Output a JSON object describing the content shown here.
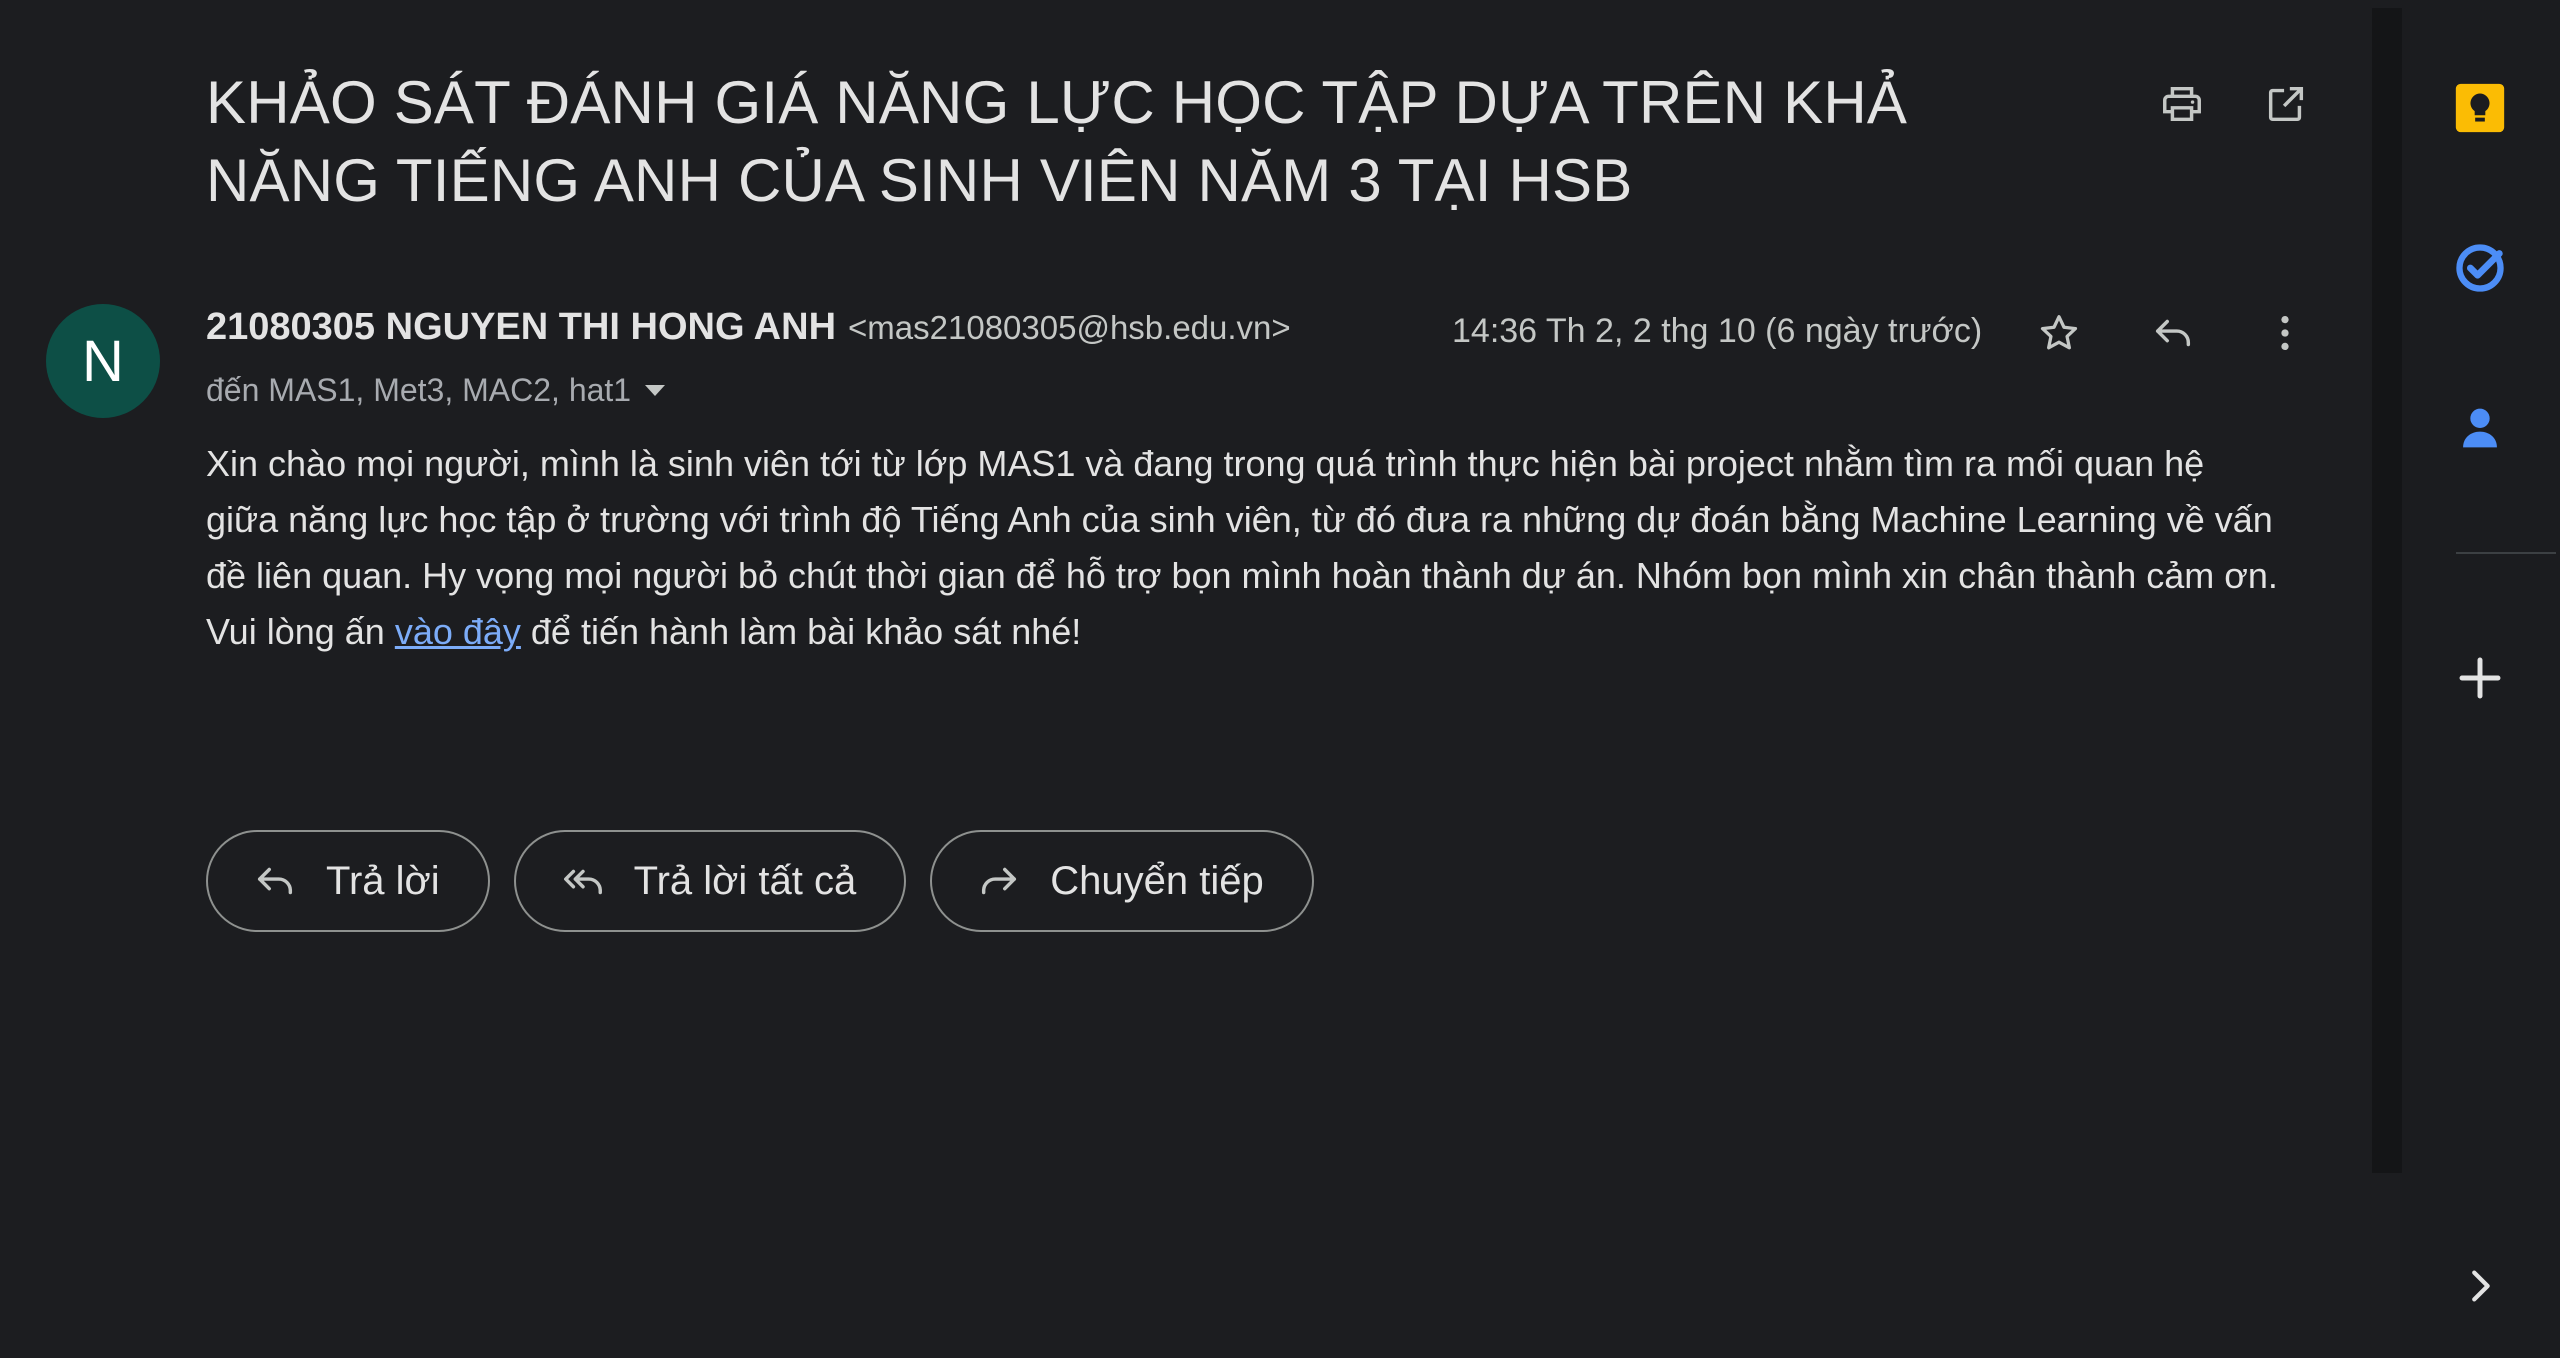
{
  "email": {
    "subject": "KHẢO SÁT ĐÁNH GIÁ NĂNG LỰC HỌC TẬP DỰA TRÊN KHẢ NĂNG TIẾNG ANH CỦA SINH VIÊN NĂM 3 TẠI HSB",
    "sender": {
      "avatar_letter": "N",
      "avatar_color": "#0d4f46",
      "name": "21080305 NGUYEN THI HONG ANH",
      "email": "<mas21080305@hsb.edu.vn>"
    },
    "timestamp": "14:36 Th 2, 2 thg 10 (6 ngày trước)",
    "recipients": "đến MAS1, Met3, MAC2, hat1",
    "body": {
      "paragraph": "Xin chào mọi người, mình là sinh viên tới từ lớp MAS1 và đang trong quá trình thực hiện bài project nhằm tìm ra mối quan hệ giữa năng lực học tập ở trường với trình độ Tiếng Anh của sinh viên, từ đó đưa ra những dự đoán bằng Machine Learning về vấn đề liên quan. Hy vọng mọi người bỏ chút thời gian để hỗ trợ bọn mình hoàn thành dự án. Nhóm bọn mình xin chân thành cảm ơn.",
      "cta_prefix": "Vui lòng ấn ",
      "cta_link": "vào đây",
      "cta_suffix": " để tiến hành làm bài khảo sát nhé!"
    }
  },
  "header_actions": {
    "print_icon": "print-icon",
    "open_new_window_icon": "open-in-new-icon"
  },
  "message_actions": {
    "star_icon": "star-icon",
    "reply_icon": "reply-icon",
    "more_icon": "more-vert-icon"
  },
  "buttons": {
    "reply": "Trả lời",
    "reply_all": "Trả lời tất cả",
    "forward": "Chuyển tiếp"
  },
  "side_panel": {
    "apps": [
      "keep-icon",
      "tasks-icon",
      "contacts-icon",
      "add-icon",
      "chevron-right-icon"
    ],
    "keep_color": "#fbbc04",
    "tasks_color": "#4c8df6",
    "contacts_color": "#4c8df6"
  },
  "colors": {
    "background": "#1c1d20",
    "link": "#7cacf8",
    "text": "#e3e3e3"
  }
}
